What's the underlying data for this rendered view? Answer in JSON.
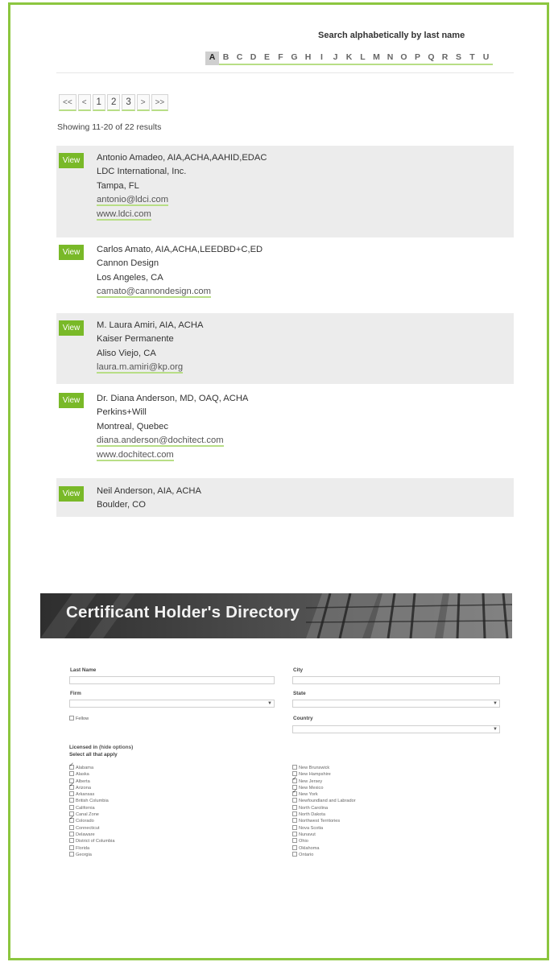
{
  "search": {
    "title": "Search alphabetically by last name",
    "letters": [
      "A",
      "B",
      "C",
      "D",
      "E",
      "F",
      "G",
      "H",
      "I",
      "J",
      "K",
      "L",
      "M",
      "N",
      "O",
      "P",
      "Q",
      "R",
      "S",
      "T",
      "U"
    ],
    "active_letter": "A"
  },
  "pagination": {
    "first": "<<",
    "prev": "<",
    "pages": [
      "1",
      "2",
      "3"
    ],
    "next": ">",
    "last": ">>",
    "showing": "Showing 11-20 of 22 results"
  },
  "results": [
    {
      "view": "View",
      "name": "Antonio Amadeo, AIA,ACHA,AAHID,EDAC",
      "firm": "LDC International, Inc.",
      "location": "Tampa, FL",
      "email": "antonio@ldci.com",
      "website": "www.ldci.com"
    },
    {
      "view": "View",
      "name": "Carlos Amato, AIA,ACHA,LEEDBD+C,ED",
      "firm": "Cannon Design",
      "location": "Los Angeles, CA",
      "email": "camato@cannondesign.com",
      "website": ""
    },
    {
      "view": "View",
      "name": "M. Laura Amiri, AIA, ACHA",
      "firm": "Kaiser Permanente",
      "location": "Aliso Viejo, CA",
      "email": "laura.m.amiri@kp.org",
      "website": ""
    },
    {
      "view": "View",
      "name": "Dr. Diana Anderson, MD, OAQ, ACHA",
      "firm": "Perkins+Will",
      "location": "Montreal, Quebec",
      "email": "diana.anderson@dochitect.com",
      "website": "www.dochitect.com"
    },
    {
      "view": "View",
      "name": "Neil Anderson, AIA, ACHA",
      "firm": "Boulder, CO",
      "location": "",
      "email": "",
      "website": ""
    }
  ],
  "directory": {
    "title": "Certificant Holder's Directory",
    "last_name_label": "Last Name",
    "city_label": "City",
    "firm_label": "Firm",
    "state_label": "State",
    "fellow_label": "Fellow",
    "country_label": "Country",
    "licensed_label": "Licensed in",
    "hide_options": "(hide options)",
    "select_all": "Select all that apply",
    "left_states": [
      {
        "name": "Alabama",
        "checked": true
      },
      {
        "name": "Alaska",
        "checked": false
      },
      {
        "name": "Alberta",
        "checked": false
      },
      {
        "name": "Arizona",
        "checked": true
      },
      {
        "name": "Arkansas",
        "checked": false
      },
      {
        "name": "British Columbia",
        "checked": false
      },
      {
        "name": "California",
        "checked": false
      },
      {
        "name": "Canal Zone",
        "checked": false
      },
      {
        "name": "Colorado",
        "checked": true
      },
      {
        "name": "Connecticut",
        "checked": false
      },
      {
        "name": "Delaware",
        "checked": false
      },
      {
        "name": "District of Columbia",
        "checked": false
      },
      {
        "name": "Florida",
        "checked": false
      },
      {
        "name": "Georgia",
        "checked": false
      }
    ],
    "right_states": [
      {
        "name": "New Brunswick",
        "checked": false
      },
      {
        "name": "New Hampshire",
        "checked": false
      },
      {
        "name": "New Jersey",
        "checked": true
      },
      {
        "name": "New Mexico",
        "checked": false
      },
      {
        "name": "New York",
        "checked": true
      },
      {
        "name": "Newfoundland and Labrador",
        "checked": false
      },
      {
        "name": "North Carolina",
        "checked": false
      },
      {
        "name": "North Dakota",
        "checked": false
      },
      {
        "name": "Northwest Territories",
        "checked": false
      },
      {
        "name": "Nova Scotia",
        "checked": false
      },
      {
        "name": "Nunavut",
        "checked": false
      },
      {
        "name": "Ohio",
        "checked": false
      },
      {
        "name": "Oklahoma",
        "checked": false
      },
      {
        "name": "Ontario",
        "checked": false
      }
    ]
  },
  "colors": {
    "accent": "#79b928",
    "frame": "#8cc63f",
    "row_shade": "#ececec"
  }
}
